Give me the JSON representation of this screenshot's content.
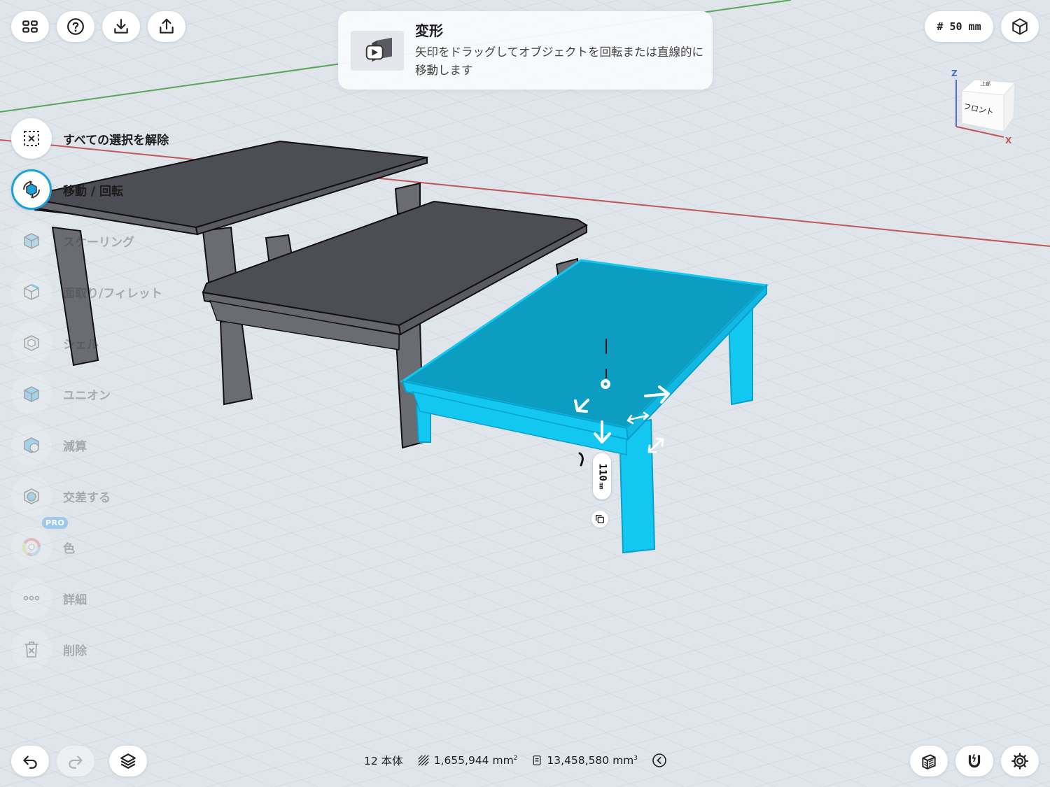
{
  "toolbar_top": {
    "grid_size_label": "# 50 mm"
  },
  "tooltip": {
    "title": "変形",
    "body": "矢印をドラッグしてオブジェクトを回転または直線的に移動します"
  },
  "tools": [
    {
      "label": "すべての選択を解除",
      "icon": "deselect-icon",
      "state": "active"
    },
    {
      "label": "移動 / 回転",
      "icon": "move-rotate-icon",
      "state": "selected"
    },
    {
      "label": "スケーリング",
      "icon": "scale-icon",
      "state": "disabled"
    },
    {
      "label": "面取り/フィレット",
      "icon": "chamfer-icon",
      "state": "disabled"
    },
    {
      "label": "シェル",
      "icon": "shell-icon",
      "state": "disabled"
    },
    {
      "label": "ユニオン",
      "icon": "union-icon",
      "state": "disabled"
    },
    {
      "label": "減算",
      "icon": "subtract-icon",
      "state": "disabled"
    },
    {
      "label": "交差する",
      "icon": "intersect-icon",
      "state": "disabled"
    },
    {
      "label": "色",
      "icon": "color-icon",
      "state": "disabled",
      "badge": "PRO"
    },
    {
      "label": "詳細",
      "icon": "more-icon",
      "state": "disabled"
    },
    {
      "label": "削除",
      "icon": "trash-icon",
      "state": "disabled"
    }
  ],
  "status": {
    "bodies": "12 本体",
    "area": "1,655,944 mm",
    "area_unit_sup": "2",
    "volume": "13,458,580 mm",
    "volume_unit_sup": "3"
  },
  "dimension": {
    "value": "110",
    "unit": "mm"
  },
  "view_cube": {
    "face_label": "フロント",
    "axis_z": "Z",
    "axis_x": "X"
  },
  "colors": {
    "selection": "#12c8f0",
    "selection_top": "#0b9ec2",
    "table_gray": "#505058",
    "grid_bg": "#dfe5ea",
    "accent": "#1aa3d8"
  }
}
